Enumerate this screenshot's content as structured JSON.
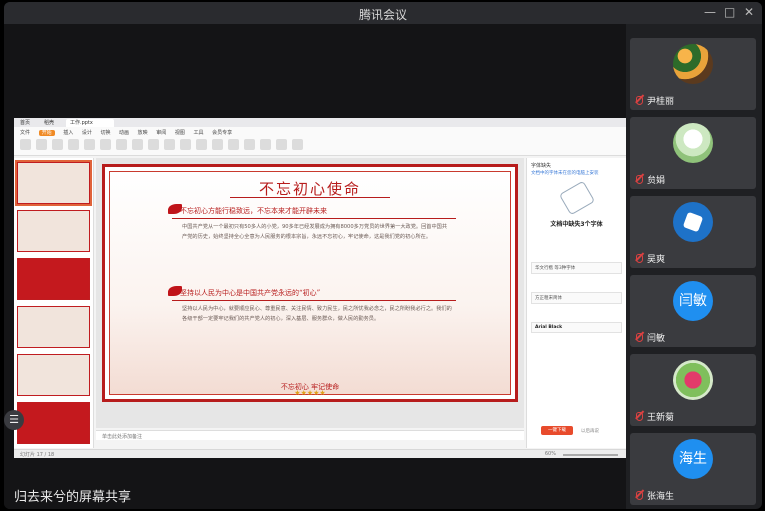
{
  "window": {
    "title": "腾讯会议",
    "controls": [
      "—",
      "□",
      "✕"
    ]
  },
  "share": {
    "caption": "归去来兮的屏幕共享"
  },
  "wps": {
    "tabs": [
      "首页",
      "稻壳",
      "工作.pptx"
    ],
    "menus": [
      "文件",
      "开始",
      "插入",
      "设计",
      "切换",
      "动画",
      "放映",
      "审阅",
      "视图",
      "工具",
      "会员专享"
    ],
    "active_menu": "开始",
    "notes_placeholder": "单击此处添加备注",
    "status_left": "幻灯片 17 / 18",
    "zoom": "60%"
  },
  "slide": {
    "title": "不忘初心使命",
    "heading1": "不忘初心方能行稳致远，不忘本来才能开辟未来",
    "para1": "中国共产党从一个最初只有50多人的小党，90多年已经发展成为拥有8000多万党员的世界第一大政党。回首中国共产党的历史，始终坚持全心全意为人民服务的根本宗旨，永远不忘初心，牢记使命，这是我们党的初心所在。",
    "heading2": "坚持以人民为中心是中国共产党永远的“初心”",
    "para2": "坚持以人民为中心，就要顺应民心、尊重民意、关注民情、致力民生，民之所忧我必念之，民之所盼我必行之。我们的各级干部一定要牢记我们的共产党人的初心，深入基层、服务群众，做人民的勤务员。",
    "stars": "★★★★★",
    "footer": "不忘初心 牢记使命"
  },
  "right_pane": {
    "title": "字体缺失",
    "subtitle": "文档中的字体未在您的电脑上安装",
    "missing": "文档中缺失3个字体",
    "cards": [
      "华文行楷 等3种字体",
      "方正粗宋简体",
      "Arial Black"
    ],
    "button": "一键下载",
    "link": "以后再说"
  },
  "participants": [
    {
      "name": "尹桂丽",
      "avatar": "flower"
    },
    {
      "name": "贠娟",
      "avatar": "bride"
    },
    {
      "name": "吴爽",
      "avatar": "hand"
    },
    {
      "name": "闫敏",
      "avatar": "text",
      "avatar_text": "闫敏"
    },
    {
      "name": "王新菊",
      "avatar": "rose"
    },
    {
      "name": "张海生",
      "avatar": "text",
      "avatar_text": "海生"
    }
  ],
  "side_toggle_icon": "☰"
}
